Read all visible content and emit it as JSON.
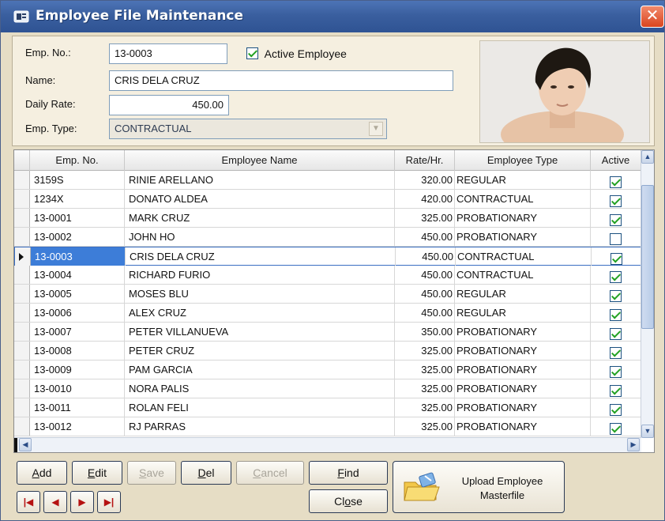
{
  "window": {
    "title": "Employee File Maintenance"
  },
  "form": {
    "emp_no_label": "Emp. No.:",
    "emp_no_value": "13-0003",
    "active_label": "Active Employee",
    "active_checked": true,
    "name_label": "Name:",
    "name_value": "CRIS DELA CRUZ",
    "daily_rate_label": "Daily Rate:",
    "daily_rate_value": "450.00",
    "emp_type_label": "Emp. Type:",
    "emp_type_value": "CONTRACTUAL"
  },
  "grid": {
    "columns": [
      "Emp. No.",
      "Employee Name",
      "Rate/Hr.",
      "Employee Type",
      "Active"
    ],
    "selected_index": 4,
    "rows": [
      {
        "no": "3159S",
        "name": "RINIE ARELLANO",
        "rate": "320.00",
        "type": "REGULAR",
        "active": true
      },
      {
        "no": "1234X",
        "name": "DONATO ALDEA",
        "rate": "420.00",
        "type": "CONTRACTUAL",
        "active": true
      },
      {
        "no": "13-0001",
        "name": "MARK CRUZ",
        "rate": "325.00",
        "type": "PROBATIONARY",
        "active": true
      },
      {
        "no": "13-0002",
        "name": "JOHN HO",
        "rate": "450.00",
        "type": "PROBATIONARY",
        "active": false
      },
      {
        "no": "13-0003",
        "name": "CRIS DELA CRUZ",
        "rate": "450.00",
        "type": "CONTRACTUAL",
        "active": true
      },
      {
        "no": "13-0004",
        "name": "RICHARD FURIO",
        "rate": "450.00",
        "type": "CONTRACTUAL",
        "active": true
      },
      {
        "no": "13-0005",
        "name": "MOSES BLU",
        "rate": "450.00",
        "type": "REGULAR",
        "active": true
      },
      {
        "no": "13-0006",
        "name": "ALEX CRUZ",
        "rate": "450.00",
        "type": "REGULAR",
        "active": true
      },
      {
        "no": "13-0007",
        "name": "PETER VILLANUEVA",
        "rate": "350.00",
        "type": "PROBATIONARY",
        "active": true
      },
      {
        "no": "13-0008",
        "name": "PETER CRUZ",
        "rate": "325.00",
        "type": "PROBATIONARY",
        "active": true
      },
      {
        "no": "13-0009",
        "name": "PAM GARCIA",
        "rate": "325.00",
        "type": "PROBATIONARY",
        "active": true
      },
      {
        "no": "13-0010",
        "name": "NORA PALIS",
        "rate": "325.00",
        "type": "PROBATIONARY",
        "active": true
      },
      {
        "no": "13-0011",
        "name": "ROLAN FELI",
        "rate": "325.00",
        "type": "PROBATIONARY",
        "active": true
      },
      {
        "no": "13-0012",
        "name": "RJ PARRAS",
        "rate": "325.00",
        "type": "PROBATIONARY",
        "active": true
      }
    ]
  },
  "buttons": {
    "add": {
      "pre": "",
      "key": "A",
      "post": "dd"
    },
    "edit": {
      "pre": "",
      "key": "E",
      "post": "dit"
    },
    "save": {
      "pre": "",
      "key": "S",
      "post": "ave"
    },
    "del": {
      "pre": "",
      "key": "D",
      "post": "el"
    },
    "cancel": {
      "pre": "",
      "key": "C",
      "post": "ancel"
    },
    "find": {
      "pre": "",
      "key": "F",
      "post": "ind"
    },
    "close": {
      "pre": "Cl",
      "key": "o",
      "post": "se"
    },
    "upload_line1": "Upload Employee",
    "upload_line2": "Masterfile"
  },
  "icons": {
    "app": "app-window-icon",
    "close": "close-icon",
    "first": "first-record-icon",
    "prev": "previous-record-icon",
    "next": "next-record-icon",
    "last": "last-record-icon",
    "upload": "folder-upload-icon"
  },
  "colors": {
    "titlebar": "#3a5f9f",
    "selection": "#3d7dd8",
    "check": "#21a121",
    "nav_arrow": "#b51212"
  }
}
